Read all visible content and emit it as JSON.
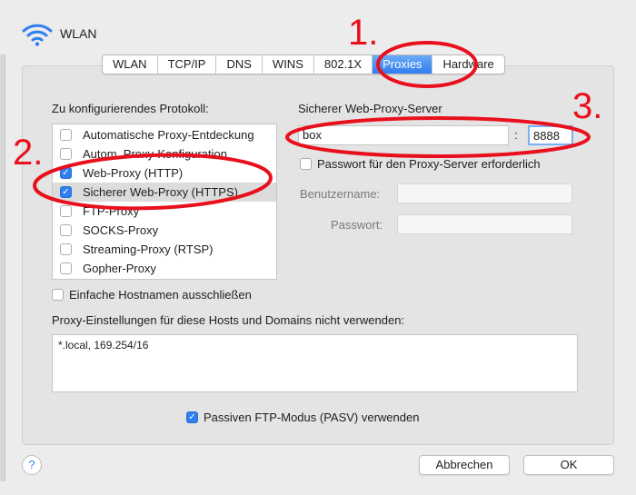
{
  "window": {
    "title": "WLAN"
  },
  "tabs": [
    {
      "label": "WLAN"
    },
    {
      "label": "TCP/IP"
    },
    {
      "label": "DNS"
    },
    {
      "label": "WINS"
    },
    {
      "label": "802.1X"
    },
    {
      "label": "Proxies",
      "active": true
    },
    {
      "label": "Hardware"
    }
  ],
  "protocols": {
    "heading": "Zu konfigurierendes Protokoll:",
    "items": [
      {
        "label": "Automatische Proxy-Entdeckung",
        "checked": false
      },
      {
        "label": "Autom. Proxy-Konfiguration",
        "checked": false
      },
      {
        "label": "Web-Proxy (HTTP)",
        "checked": true
      },
      {
        "label": "Sicherer Web-Proxy (HTTPS)",
        "checked": true,
        "selected": true
      },
      {
        "label": "FTP-Proxy",
        "checked": false
      },
      {
        "label": "SOCKS-Proxy",
        "checked": false
      },
      {
        "label": "Streaming-Proxy (RTSP)",
        "checked": false
      },
      {
        "label": "Gopher-Proxy",
        "checked": false
      }
    ]
  },
  "server": {
    "heading": "Sicherer Web-Proxy-Server",
    "host_value": "box",
    "separator": ":",
    "port_value": "8888",
    "password_required_label": "Passwort für den Proxy-Server erforderlich",
    "password_required_checked": false,
    "username_label": "Benutzername:",
    "username_value": "",
    "password_label": "Passwort:",
    "password_value": ""
  },
  "exclude_simple_hostnames": {
    "label": "Einfache Hostnamen ausschließen",
    "checked": false
  },
  "bypass": {
    "label": "Proxy-Einstellungen für diese Hosts und Domains nicht verwenden:",
    "value": "*.local, 169.254/16"
  },
  "passive_ftp": {
    "label": "Passiven FTP-Modus (PASV) verwenden",
    "checked": true
  },
  "buttons": {
    "help": "?",
    "cancel": "Abbrechen",
    "ok": "OK"
  },
  "annotations": {
    "color": "#e8101c",
    "one": "1.",
    "two": "2.",
    "three": "3."
  },
  "colors": {
    "accent": "#2f7ff0",
    "annotation": "#e8101c"
  }
}
